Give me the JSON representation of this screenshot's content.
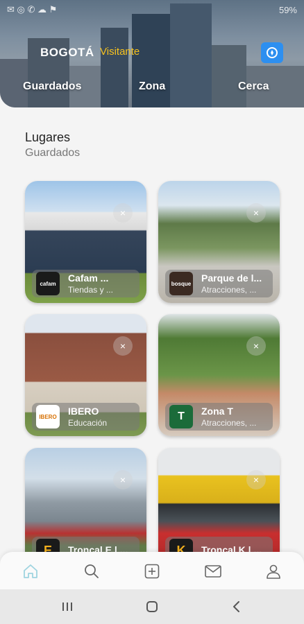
{
  "status_bar": {
    "left_icons": "notifications",
    "right": "59%"
  },
  "header": {
    "logo": "BOGOTÁ",
    "visitor_label": "Visitante",
    "menu_icon": "compass-icon",
    "tabs": [
      {
        "label": "Guardados"
      },
      {
        "label": "Zona"
      },
      {
        "label": "Cerca"
      }
    ]
  },
  "section": {
    "title": "Lugares",
    "subtitle": "Guardados"
  },
  "cards": [
    {
      "name": "Cafam ...",
      "category": "Tiendas y ...",
      "thumb": "cafam",
      "close": "×"
    },
    {
      "name": "Parque de l...",
      "category": "Atracciones, ...",
      "thumb": "bosque",
      "close": "×"
    },
    {
      "name": "IBERO",
      "category": "Educación",
      "thumb": "IBERO",
      "close": "×"
    },
    {
      "name": "Zona T",
      "category": "Atracciones, ...",
      "thumb": "T",
      "close": "×"
    },
    {
      "name": "Troncal E | ...",
      "category": "",
      "thumb": "E",
      "close": "×"
    },
    {
      "name": "Troncal K | ...",
      "category": "",
      "thumb": "K",
      "close": "×"
    }
  ],
  "bottom_nav": [
    {
      "icon": "home-icon"
    },
    {
      "icon": "search-icon"
    },
    {
      "icon": "add-icon"
    },
    {
      "icon": "mail-icon"
    },
    {
      "icon": "profile-icon"
    }
  ],
  "colors": {
    "accent": "#2d8ff0",
    "visitor": "#f7c21e"
  }
}
